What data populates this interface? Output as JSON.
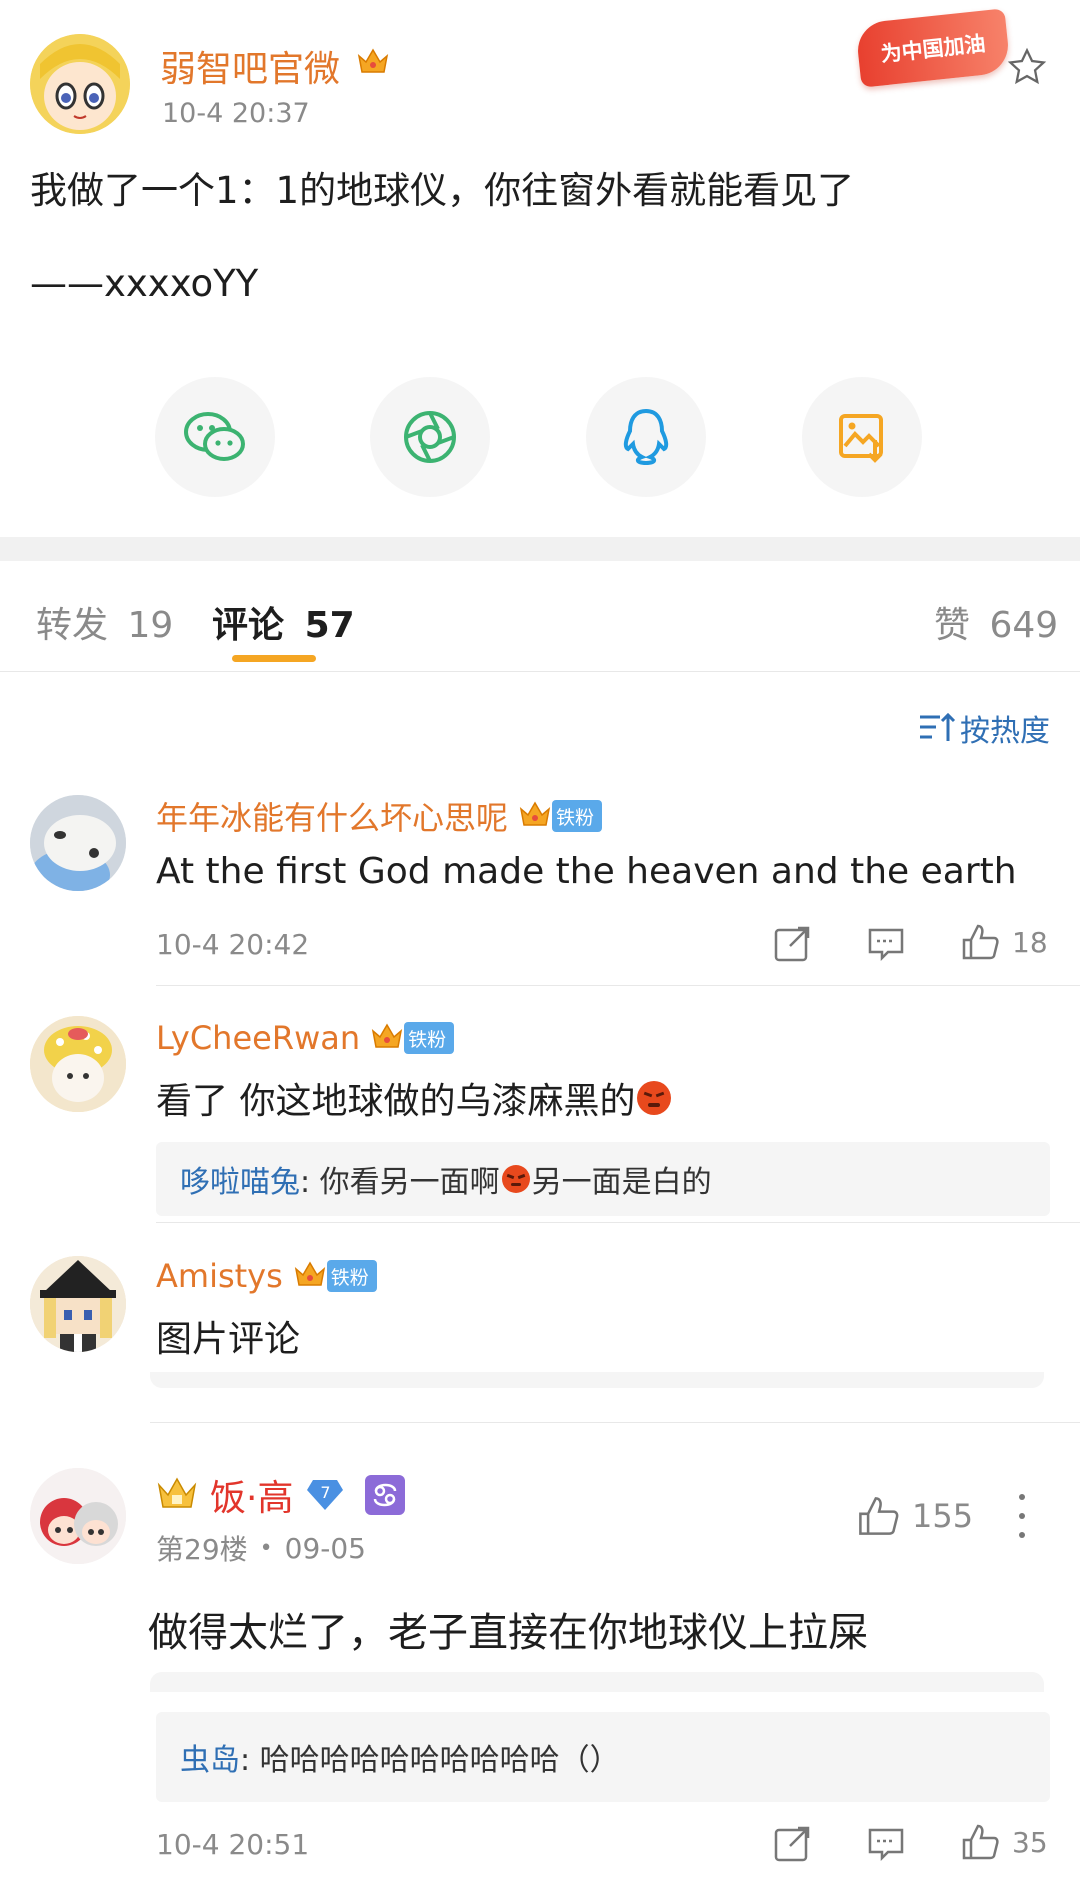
{
  "post": {
    "author_name": "弱智吧官微",
    "time": "10-4 20:37",
    "text_line1": "我做了一个1：1的地球仪，你往窗外看就能看见了",
    "text_line2": "——xxxxoYY",
    "banner_text": "为中国加油"
  },
  "share": {
    "items": [
      {
        "name": "wechat-icon"
      },
      {
        "name": "moments-icon"
      },
      {
        "name": "qq-icon"
      },
      {
        "name": "save-image-icon"
      }
    ]
  },
  "tabs": {
    "repost_label": "转发",
    "repost_count": "19",
    "comment_label": "评论",
    "comment_count": "57",
    "like_label": "赞",
    "like_count": "649"
  },
  "sort": {
    "label": "按热度"
  },
  "comments": [
    {
      "name": "年年冰能有什么坏心思呢",
      "badge": "铁粉",
      "text": "At the first God made the heaven and the earth",
      "time": "10-4 20:42",
      "likes": "18"
    },
    {
      "name": "LyCheeRwan",
      "badge": "铁粉",
      "text": "看了 你这地球做的乌漆麻黑的",
      "reply_name": "哆啦喵兔",
      "reply_text": ": 你看另一面啊",
      "reply_text2": "另一面是白的"
    },
    {
      "name": "Amistys",
      "badge": "铁粉",
      "text": "图片评论"
    },
    {
      "name": "饭·高",
      "level": "7",
      "floor": "第29楼",
      "date": "09-05",
      "likes": "155",
      "text": "做得太烂了，老子直接在你地球仪上拉屎",
      "reply_name": "虫岛",
      "reply_text": ": 哈哈哈哈哈哈哈哈哈哈（）",
      "time": "10-4 20:51",
      "reply_likes": "35"
    }
  ],
  "colors": {
    "accent_orange": "#f5a623",
    "name_orange": "#e2772b",
    "link_blue": "#2f6fb4",
    "fans_badge": "#5aa9ea"
  }
}
